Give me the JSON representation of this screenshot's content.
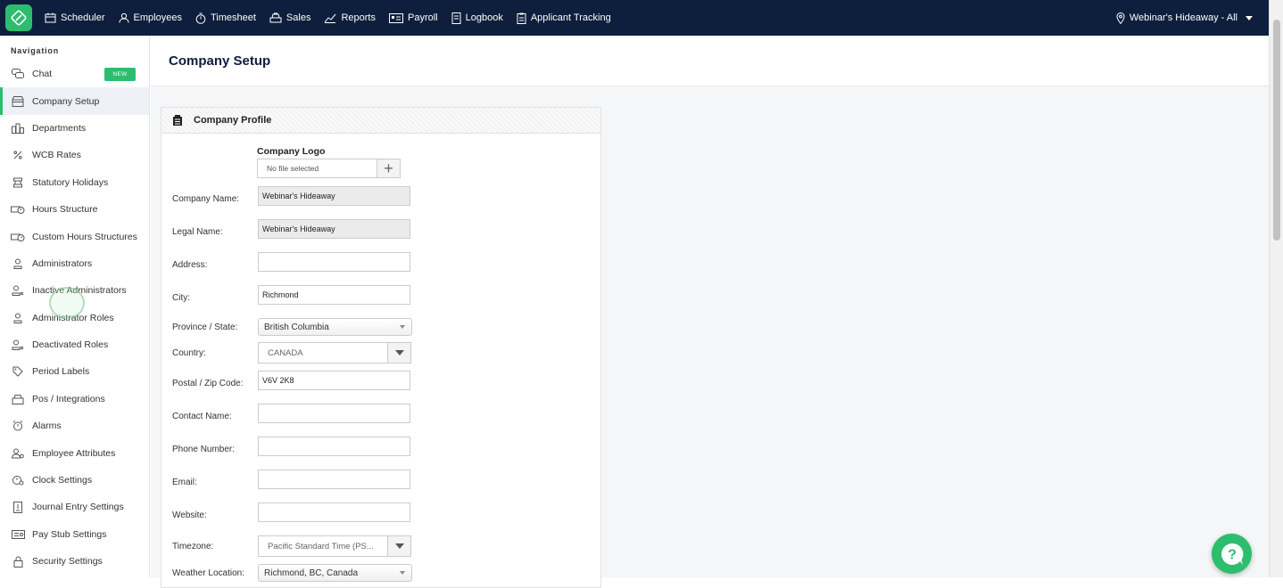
{
  "topbar": {
    "nav": [
      {
        "label": "Scheduler",
        "icon": "calendar-icon"
      },
      {
        "label": "Employees",
        "icon": "person-icon"
      },
      {
        "label": "Timesheet",
        "icon": "stopwatch-icon"
      },
      {
        "label": "Sales",
        "icon": "register-icon"
      },
      {
        "label": "Reports",
        "icon": "chart-icon"
      },
      {
        "label": "Payroll",
        "icon": "card-icon"
      },
      {
        "label": "Logbook",
        "icon": "book-icon"
      },
      {
        "label": "Applicant Tracking",
        "icon": "clipboard-icon"
      }
    ],
    "location": "Webinar's Hideaway - All"
  },
  "sidebar": {
    "heading": "Navigation",
    "new_badge": "NEW",
    "items": [
      {
        "label": "Chat",
        "icon": "chat-icon"
      },
      {
        "label": "Company Setup",
        "icon": "store-icon"
      },
      {
        "label": "Departments",
        "icon": "departments-icon"
      },
      {
        "label": "WCB Rates",
        "icon": "percent-icon"
      },
      {
        "label": "Statutory Holidays",
        "icon": "holiday-icon"
      },
      {
        "label": "Hours Structure",
        "icon": "hours-icon"
      },
      {
        "label": "Custom Hours Structures",
        "icon": "custom-hours-icon"
      },
      {
        "label": "Administrators",
        "icon": "admin-icon"
      },
      {
        "label": "Inactive Administrators",
        "icon": "inactive-admin-icon"
      },
      {
        "label": "Administrator Roles",
        "icon": "admin-role-icon"
      },
      {
        "label": "Deactivated Roles",
        "icon": "deactivated-role-icon"
      },
      {
        "label": "Period Labels",
        "icon": "tag-icon"
      },
      {
        "label": "Pos / Integrations",
        "icon": "integration-icon"
      },
      {
        "label": "Alarms",
        "icon": "alarm-icon"
      },
      {
        "label": "Employee Attributes",
        "icon": "attributes-icon"
      },
      {
        "label": "Clock Settings",
        "icon": "clock-icon"
      },
      {
        "label": "Journal Entry Settings",
        "icon": "journal-icon"
      },
      {
        "label": "Pay Stub Settings",
        "icon": "paystub-icon"
      },
      {
        "label": "Security Settings",
        "icon": "lock-icon"
      }
    ]
  },
  "page": {
    "title": "Company Setup",
    "card_title": "Company Profile",
    "logo_label": "Company Logo",
    "file_placeholder": "No file selected",
    "fields": {
      "company_name": {
        "label": "Company Name:",
        "value": "Webinar's Hideaway"
      },
      "legal_name": {
        "label": "Legal Name:",
        "value": "Webinar's Hideaway"
      },
      "address": {
        "label": "Address:",
        "value": ""
      },
      "city": {
        "label": "City:",
        "value": "Richmond"
      },
      "province": {
        "label": "Province / State:",
        "value": "British Columbia"
      },
      "country": {
        "label": "Country:",
        "value": "CANADA"
      },
      "postal": {
        "label": "Postal / Zip Code:",
        "value": "V6V 2K8"
      },
      "contact": {
        "label": "Contact Name:",
        "value": ""
      },
      "phone": {
        "label": "Phone Number:",
        "value": ""
      },
      "email": {
        "label": "Email:",
        "value": ""
      },
      "website": {
        "label": "Website:",
        "value": ""
      },
      "timezone": {
        "label": "Timezone:",
        "value": "Pacific Standard Time (PS..."
      },
      "weather": {
        "label": "Weather Location:",
        "value": "Richmond, BC, Canada"
      }
    }
  },
  "colors": {
    "topbar": "#0e1f3d",
    "accent": "#2dbd6e"
  }
}
